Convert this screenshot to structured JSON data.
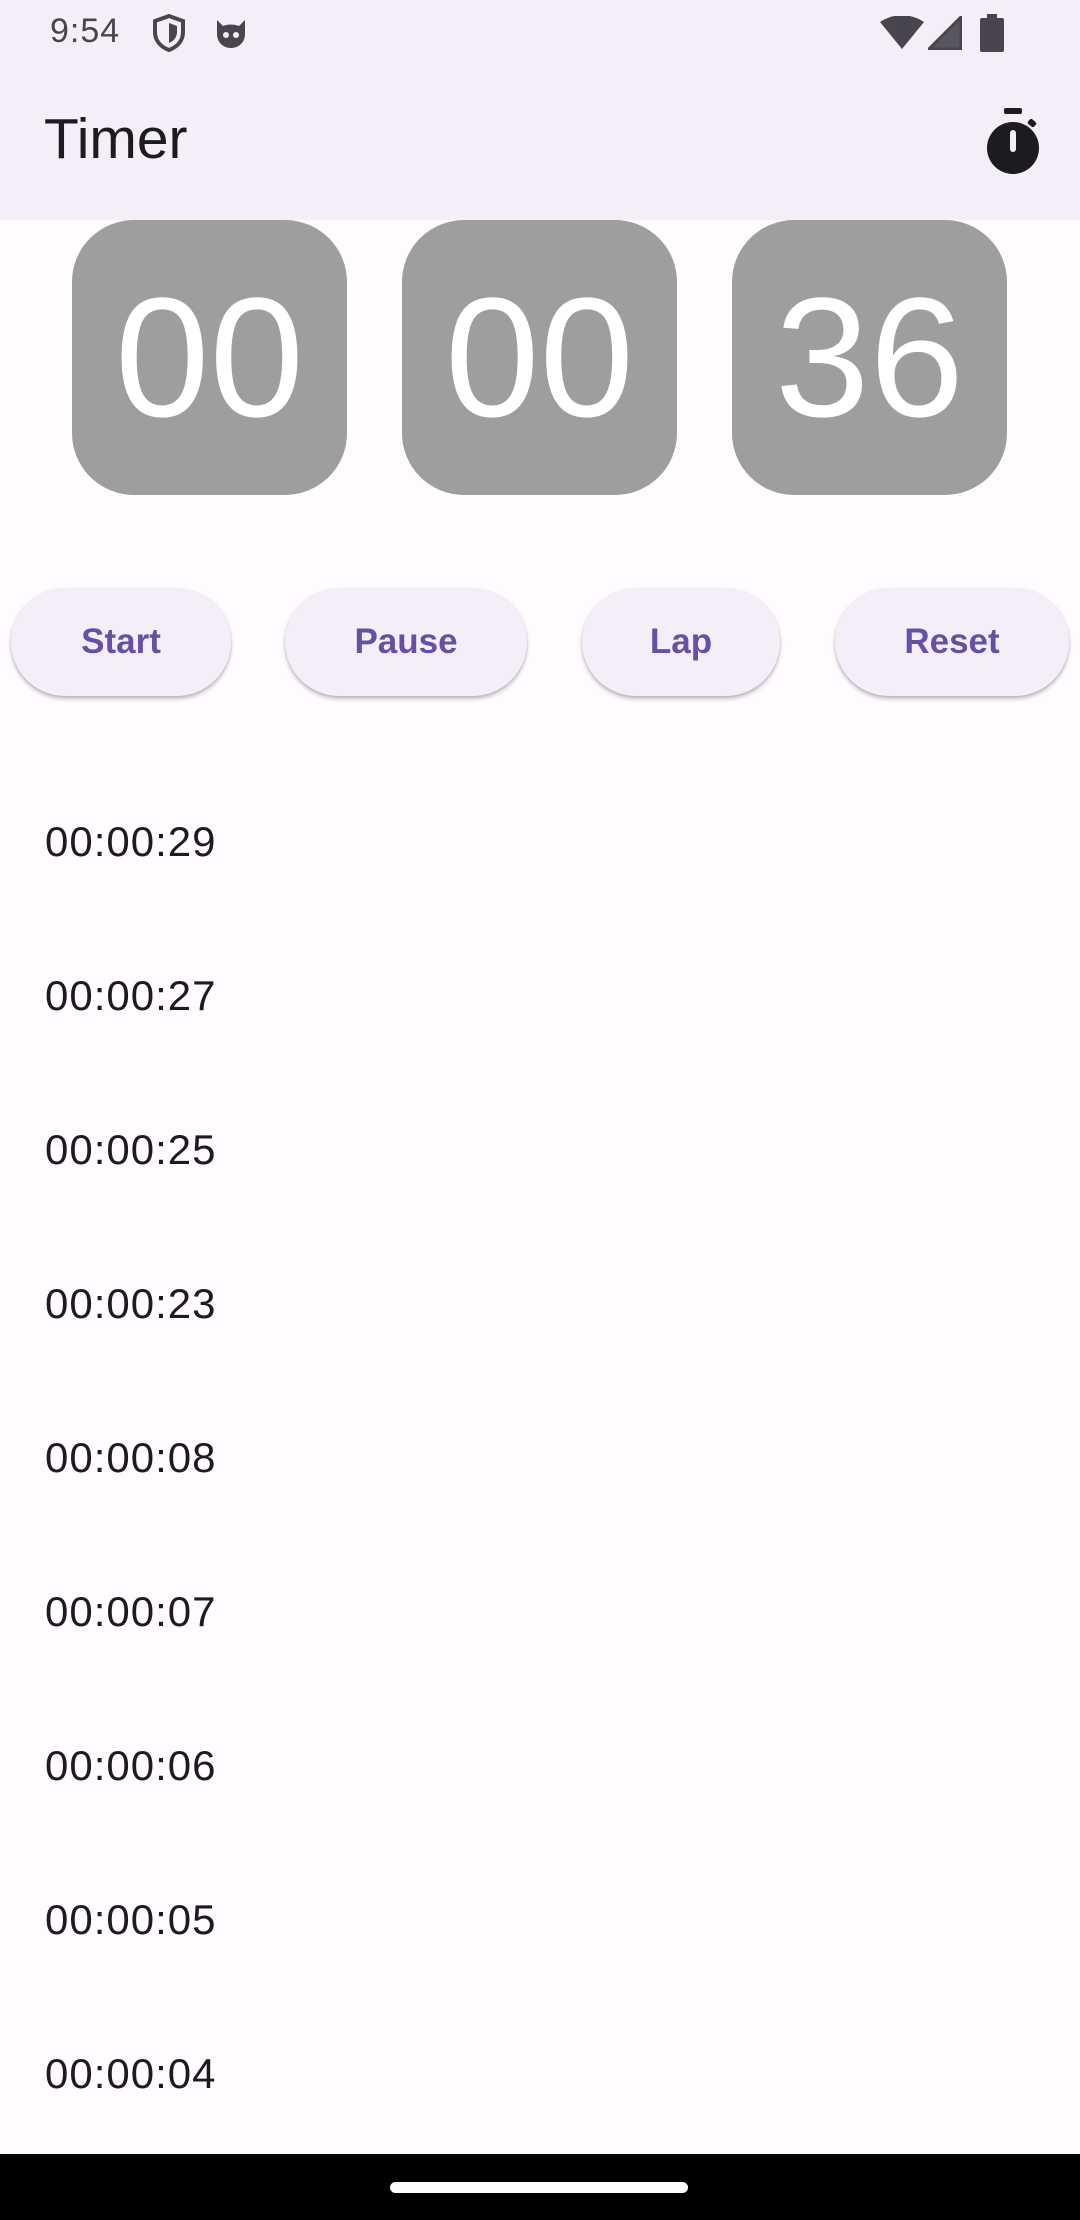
{
  "status_bar": {
    "time": "9:54",
    "icons": [
      "shield-icon",
      "cat-face-icon",
      "wifi-icon",
      "signal-icon",
      "battery-icon"
    ]
  },
  "app_bar": {
    "title": "Timer",
    "action_icon": "stopwatch-icon"
  },
  "timer": {
    "hours": "00",
    "minutes": "00",
    "seconds": "36"
  },
  "buttons": {
    "start": "Start",
    "pause": "Pause",
    "lap": "Lap",
    "reset": "Reset"
  },
  "laps": [
    "00:00:29",
    "00:00:27",
    "00:00:25",
    "00:00:23",
    "00:00:08",
    "00:00:07",
    "00:00:06",
    "00:00:05",
    "00:00:04"
  ],
  "colors": {
    "app_bar_bg": "#F3EEF8",
    "digit_box_bg": "#9E9E9E",
    "button_text": "#6750A4",
    "page_bg": "#FFFBFE"
  }
}
